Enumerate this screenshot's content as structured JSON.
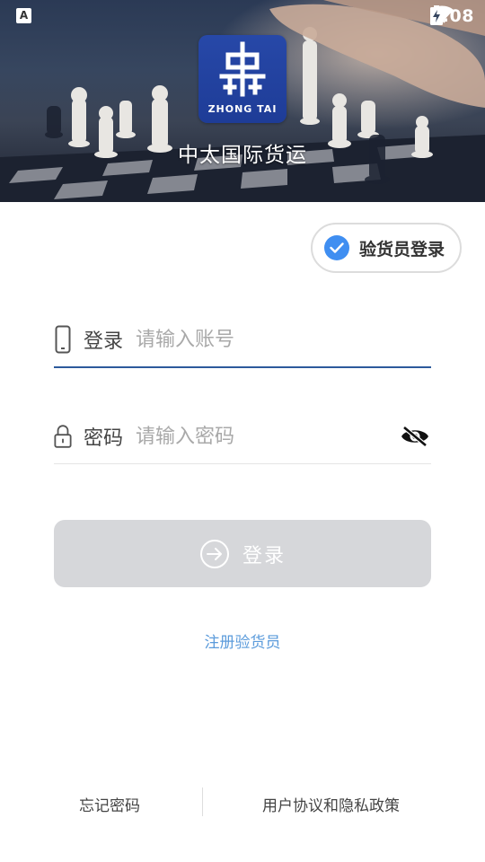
{
  "status_bar": {
    "time": "1:08",
    "left_icon": "A",
    "icons": [
      "wifi-icon",
      "signal-off-icon",
      "battery-charging-icon"
    ]
  },
  "header": {
    "logo_text": "ZHONG TAI",
    "app_title": "中太国际货运",
    "background": "chess-board-photo"
  },
  "inspector_toggle": {
    "label": "验货员登录",
    "checked": true,
    "color": "#3f8ef1"
  },
  "account": {
    "label": "登录",
    "placeholder": "请输入账号",
    "value": "",
    "icon": "phone-icon"
  },
  "password": {
    "label": "密码",
    "placeholder": "请输入密码",
    "value": "",
    "icon": "lock-icon",
    "toggle_icon": "eye-off-icon"
  },
  "login_button": {
    "label": "登录",
    "icon": "arrow-right-circle-icon"
  },
  "register_link": "注册验货员",
  "footer": {
    "forgot_password": "忘记密码",
    "policy": "用户协议和隐私政策"
  },
  "colors": {
    "accent": "#3f8ef1",
    "link": "#5b9bdb",
    "input_active_underline": "#2c5a9c",
    "button_disabled": "#d6d7da"
  }
}
